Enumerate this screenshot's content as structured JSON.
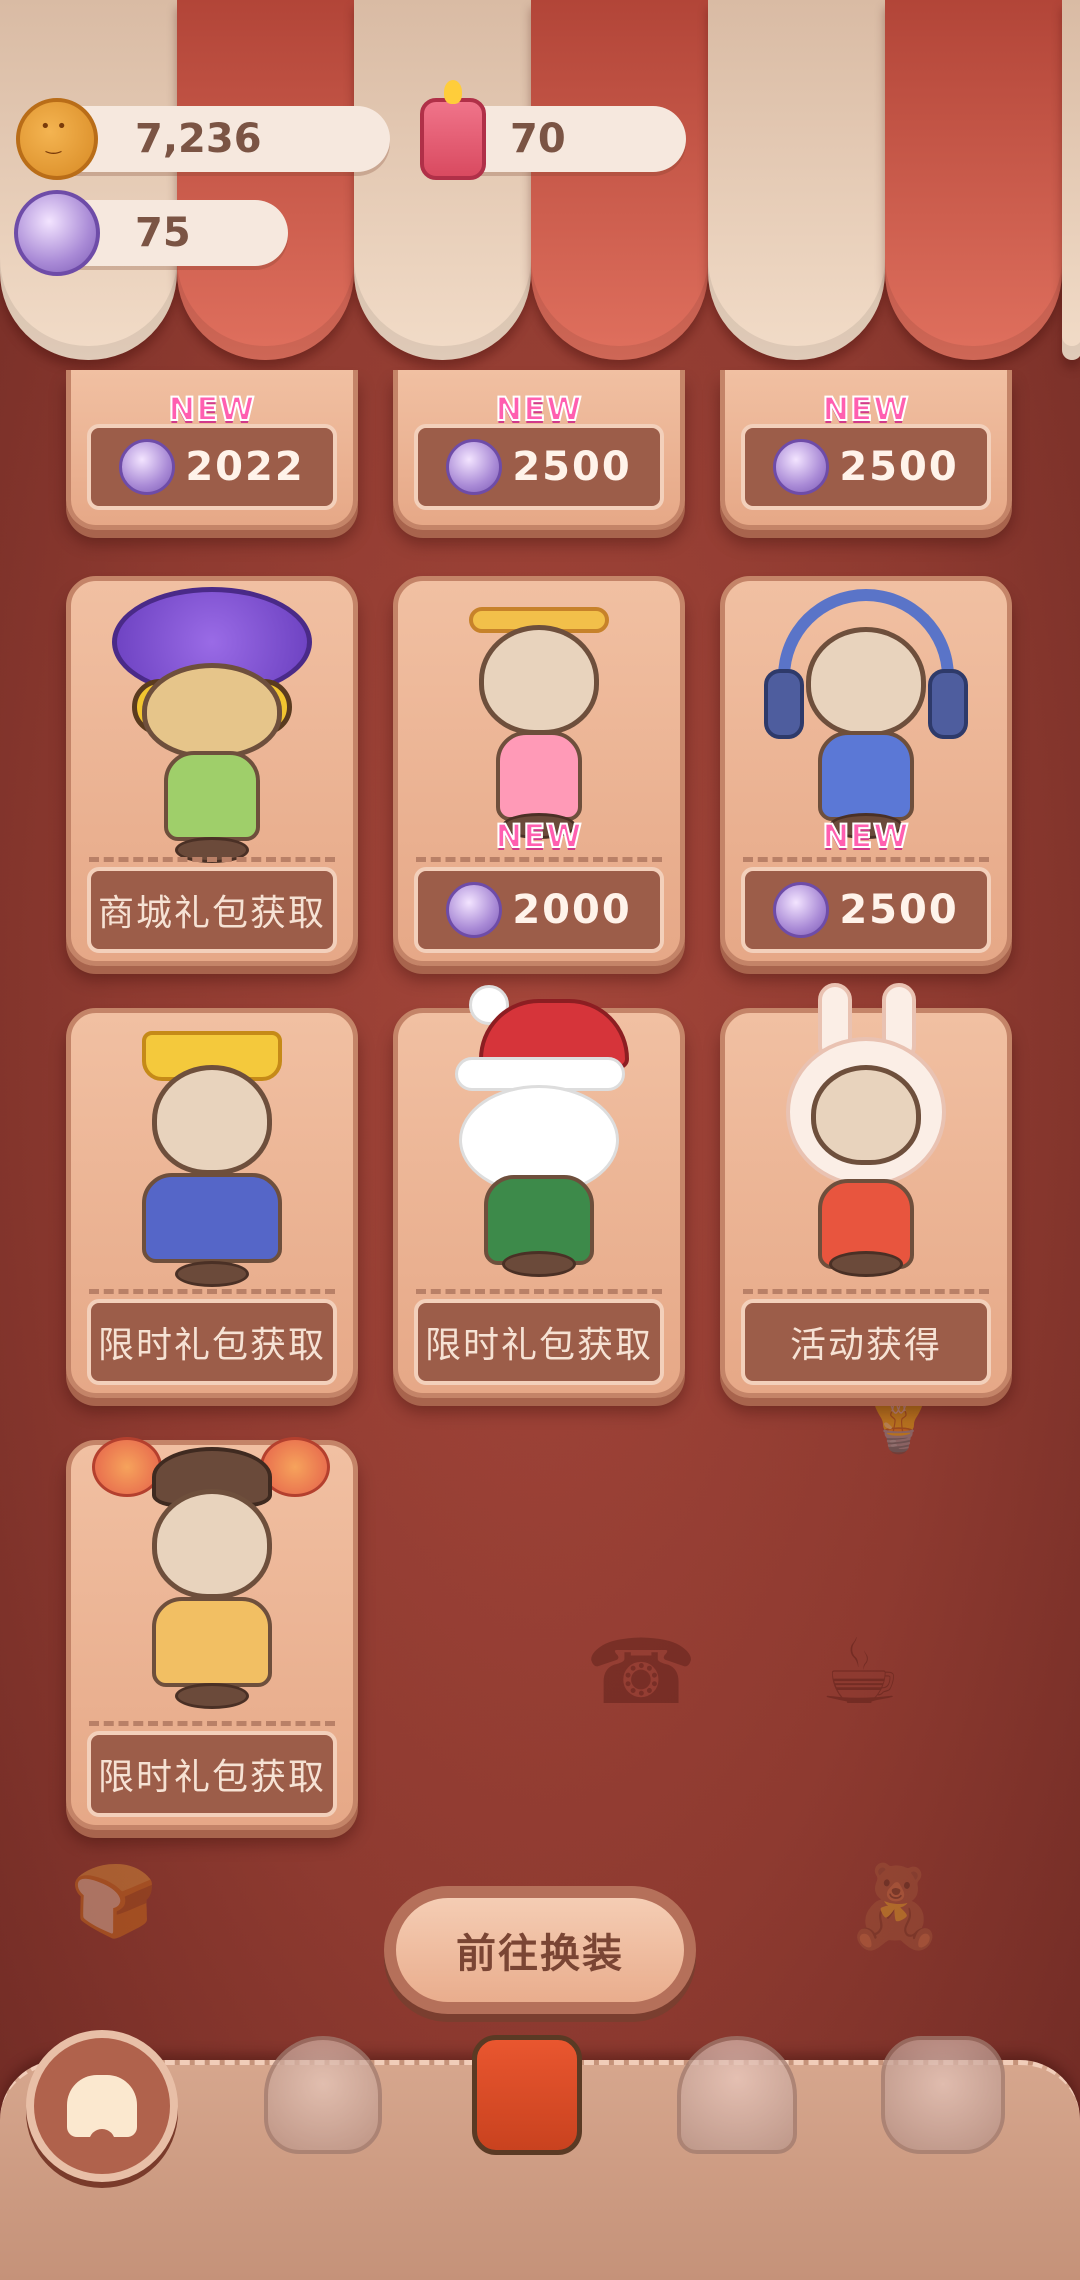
{
  "currency": {
    "cookies": {
      "icon": "cookie-icon",
      "value": "7,236"
    },
    "candles": {
      "icon": "candle-icon",
      "value": "70"
    },
    "gems": {
      "icon": "gem-icon",
      "value": "75"
    }
  },
  "top_row": [
    {
      "badge": "NEW",
      "price": "2022"
    },
    {
      "badge": "NEW",
      "price": "2500"
    },
    {
      "badge": "NEW",
      "price": "2500"
    }
  ],
  "cards": [
    {
      "name": "tiger-purple-hat-outfit",
      "label": "商城礼包获取"
    },
    {
      "name": "magical-girl-outfit",
      "badge": "NEW",
      "price": "2000"
    },
    {
      "name": "headphones-hoodie-outfit",
      "badge": "NEW",
      "price": "2500"
    },
    {
      "name": "golden-crown-cape-outfit",
      "label": "限时礼包获取"
    },
    {
      "name": "santa-claus-outfit",
      "label": "限时礼包获取"
    },
    {
      "name": "bunny-hood-outfit",
      "label": "活动获得"
    },
    {
      "name": "flower-headdress-outfit",
      "label": "限时礼包获取"
    }
  ],
  "goto_button": {
    "label": "前往换装"
  },
  "nav": {
    "items": [
      {
        "name": "nav-home",
        "icon": "tooth-icon"
      },
      {
        "name": "nav-carousel",
        "icon": "carousel-icon"
      },
      {
        "name": "nav-wardrobe",
        "icon": "outfit-icon"
      },
      {
        "name": "nav-mushroom-house",
        "icon": "mushroom-house-icon"
      },
      {
        "name": "nav-furniture",
        "icon": "lamp-table-icon"
      }
    ]
  },
  "colors": {
    "background": "#8e3a30",
    "card": "#eab193",
    "badge_new": "#ff5fb0",
    "footer": "#9c5d49"
  }
}
